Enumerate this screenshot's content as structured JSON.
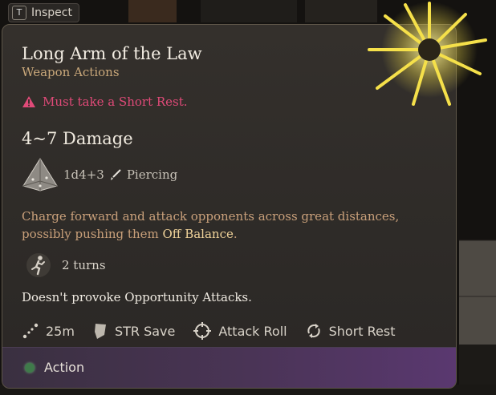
{
  "hint": {
    "key": "T",
    "label": "Inspect"
  },
  "tooltip": {
    "title": "Long Arm of the Law",
    "subtitle": "Weapon Actions",
    "warning": "Must take a Short Rest.",
    "damage": "4~7 Damage",
    "dice": "1d4+3",
    "damage_type": "Piercing",
    "description_pre": "Charge forward and attack opponents across great distances, possibly pushing them ",
    "description_highlight": "Off Balance",
    "description_post": ".",
    "turns": "2 turns",
    "opportunity": "Doesn't provoke Opportunity Attacks.",
    "stats": {
      "range": "25m",
      "save": "STR Save",
      "roll": "Attack Roll",
      "rest": "Short Rest"
    },
    "action": "Action"
  },
  "colors": {
    "warning": "#e04a78",
    "subtitle": "#c9a87a",
    "description": "#c9a07a",
    "highlight": "#f0d39a",
    "action_dot": "#3f7a4a",
    "burst": "#f5e04a"
  },
  "icons": [
    "key-t-icon",
    "warning-triangle-icon",
    "d4-die-icon",
    "piercing-icon",
    "running-figure-icon",
    "range-icon",
    "shield-icon",
    "crosshair-icon",
    "recycle-icon",
    "green-dot-icon",
    "spell-burst-icon"
  ]
}
